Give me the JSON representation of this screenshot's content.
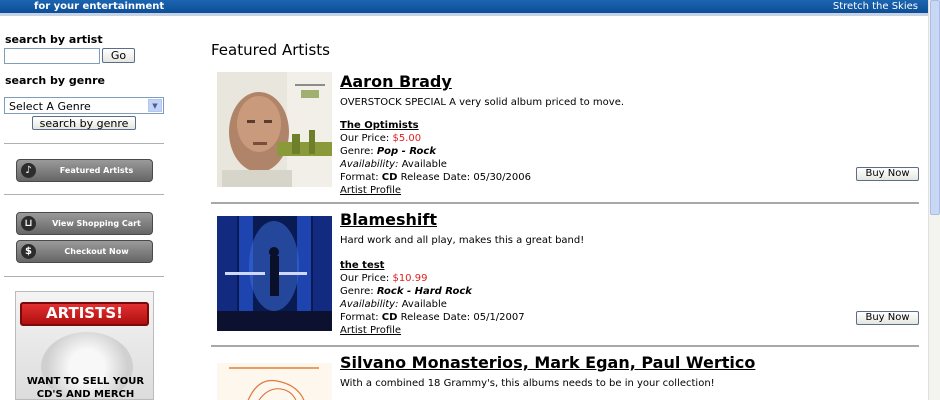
{
  "header": {
    "tagline": "for your entertainment",
    "right_text": "Stretch the Skies"
  },
  "sidebar": {
    "search_artist_label": "search by artist",
    "artist_input_value": "",
    "go_label": "Go",
    "search_genre_label": "search by genre",
    "genre_selected": "Select A Genre",
    "genre_button_label": "search by genre",
    "featured_artists_label": "Featured Artists",
    "shopping_cart_label": "View Shopping Cart",
    "checkout_label": "Checkout Now",
    "promo": {
      "title": "ARTISTS!",
      "line1": "WANT TO SELL YOUR",
      "line2": "CD'S AND MERCH"
    }
  },
  "main": {
    "heading": "Featured Artists",
    "artists": [
      {
        "name": "Aaron Brady",
        "blurb": "OVERSTOCK SPECIAL A very solid album priced to move.",
        "album": "The Optimists",
        "price_label": "Our Price:",
        "price": "$5.00",
        "genre_label": "Genre:",
        "genre": "Pop - Rock",
        "availability_label": "Availability:",
        "availability": "Available",
        "format_label": "Format:",
        "format": "CD",
        "release_label": "Release Date:",
        "release_date": "05/30/2006",
        "profile_label": "Artist Profile",
        "buy_label": "Buy Now"
      },
      {
        "name": "Blameshift",
        "blurb": "Hard work and all play, makes this a great band!",
        "album": "the test",
        "price_label": "Our Price:",
        "price": "$10.99",
        "genre_label": "Genre:",
        "genre": "Rock - Hard Rock",
        "availability_label": "Availability:",
        "availability": "Available",
        "format_label": "Format:",
        "format": "CD",
        "release_label": "Release Date:",
        "release_date": "05/1/2007",
        "profile_label": "Artist Profile",
        "buy_label": "Buy Now"
      },
      {
        "name": "Silvano Monasterios, Mark Egan, Paul Wertico",
        "blurb": "With a combined 18 Grammy's, this albums needs to be in your collection!"
      }
    ]
  },
  "colors": {
    "top_bar": "#0d4f97",
    "price_red": "#e0201c",
    "nav_button_gray": "#808080",
    "promo_red": "#c81c1c"
  }
}
